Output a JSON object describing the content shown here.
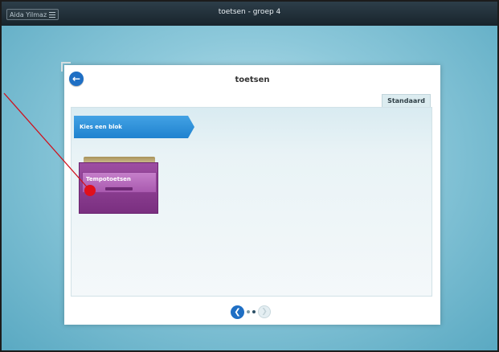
{
  "topbar": {
    "user_name": "Aida Yilmaz",
    "window_title": "toetsen - groep 4"
  },
  "panel": {
    "title": "toetsen",
    "tab_label": "Standaard",
    "step_label": "Kies een blok",
    "block_label": "Tempotoetsen"
  },
  "icons": {
    "back": "back-arrow-icon",
    "menu": "hamburger-menu-icon",
    "pager_prev": "chevron-left-icon",
    "pager_next": "chevron-right-icon"
  },
  "colors": {
    "accent_blue": "#1f6fc4",
    "banner_blue": "#2d8fd8",
    "drawer_purple": "#8e3f94",
    "annotation_red": "#d0101c"
  }
}
